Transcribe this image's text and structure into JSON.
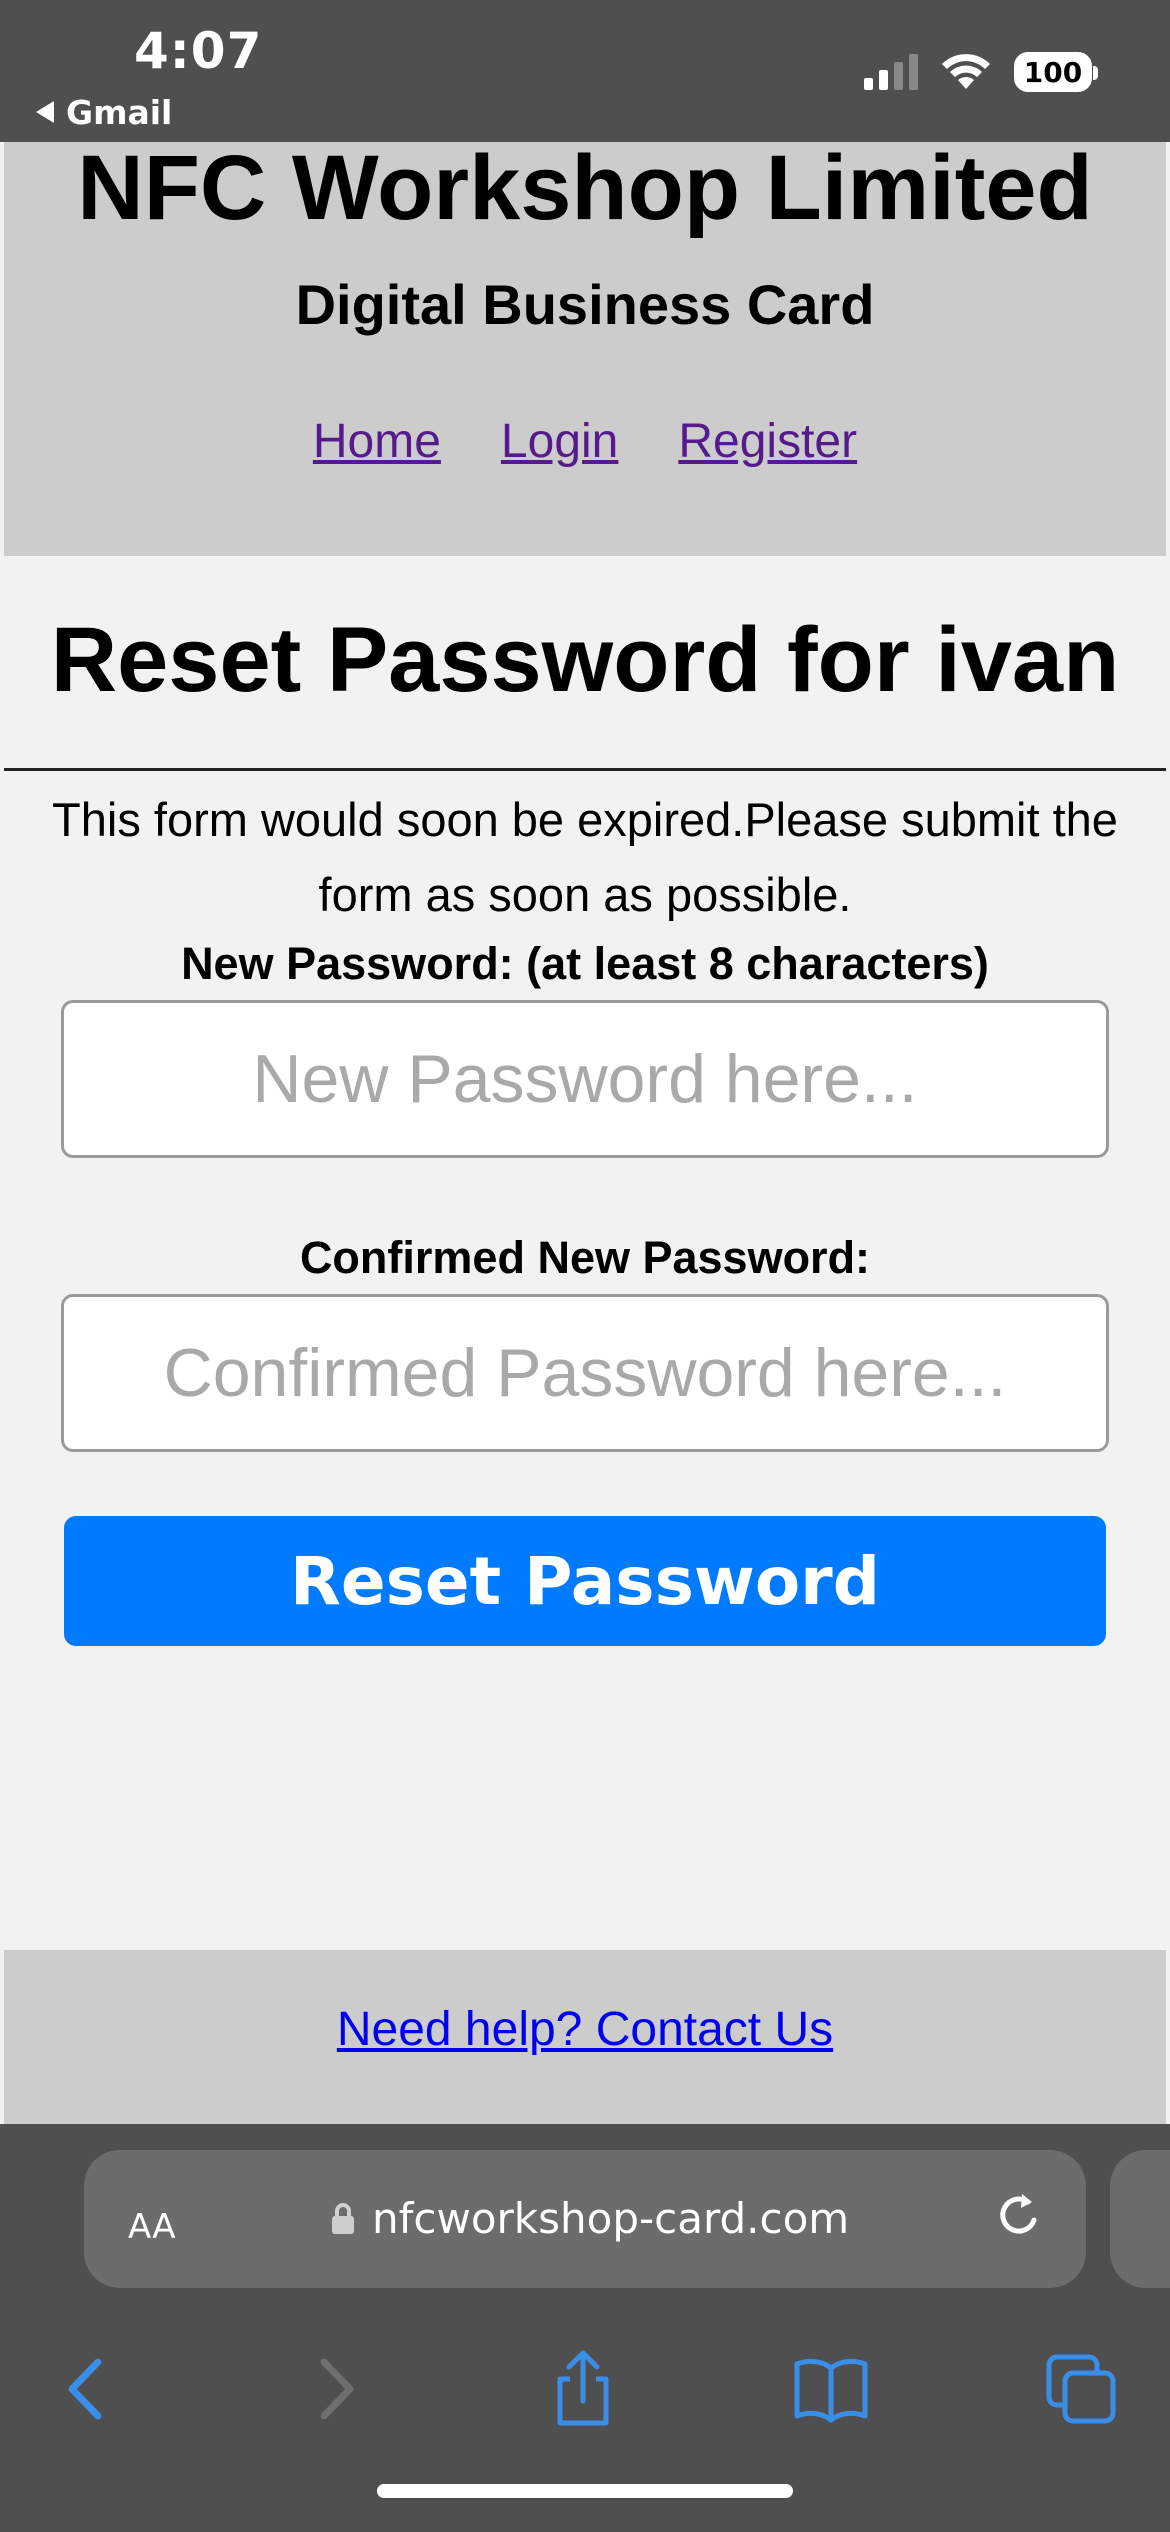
{
  "status_bar": {
    "time": "4:07",
    "back_app": "Gmail",
    "battery": "100",
    "icons": [
      "cellular-signal-icon",
      "wifi-icon",
      "battery-icon"
    ]
  },
  "header": {
    "title": "NFC Workshop Limited",
    "subtitle": "Digital Business Card",
    "nav": [
      {
        "label": "Home"
      },
      {
        "label": "Login"
      },
      {
        "label": "Register"
      }
    ]
  },
  "main": {
    "heading": "Reset Password for ivan",
    "notice": "This form would soon be expired.Please submit the form as soon as possible.",
    "new_password": {
      "label": "New Password: (at least 8 characters)",
      "placeholder": "New Password here...",
      "value": ""
    },
    "confirm_password": {
      "label": "Confirmed New Password:",
      "placeholder": "Confirmed Password here...",
      "value": ""
    },
    "submit_label": "Reset Password"
  },
  "footer": {
    "help_link": "Need help? Contact Us"
  },
  "browser": {
    "aa_label": "AA",
    "url": "nfcworkshop-card.com",
    "toolbar_icons": [
      "back-icon",
      "forward-icon",
      "share-icon",
      "bookmarks-icon",
      "tabs-icon"
    ]
  },
  "colors": {
    "primary_button": "#007bff",
    "header_bg": "#cccccc",
    "page_bg": "#f2f2f2",
    "visited_link": "#551a8b",
    "link": "#0000ee",
    "browser_chrome": "#4f4f4f",
    "safari_accent": "#3a8ee8"
  }
}
